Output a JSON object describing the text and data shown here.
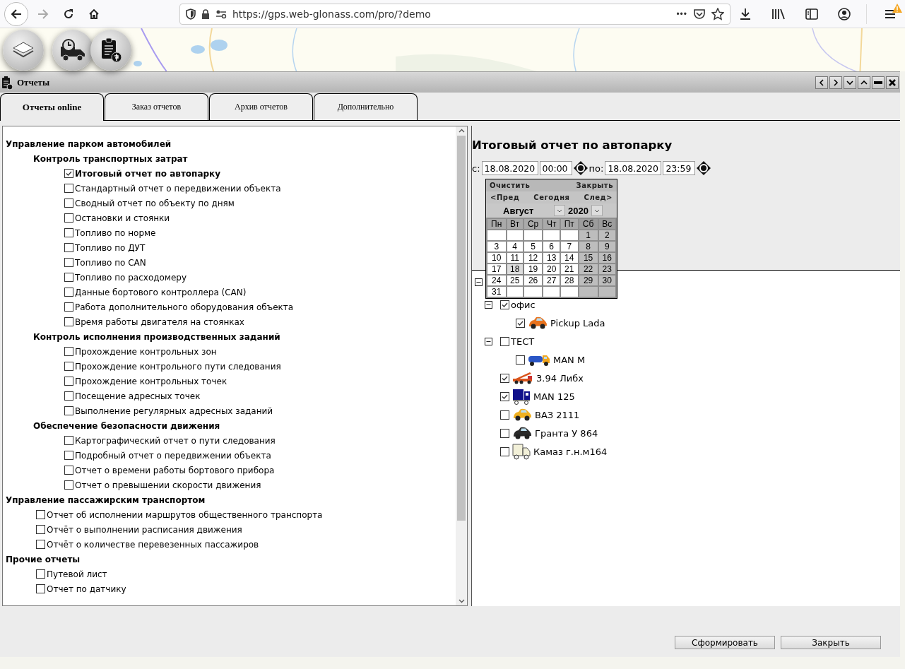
{
  "browser": {
    "url": "https://gps.web-glonass.com/pro/?demo",
    "more": "•••"
  },
  "window": {
    "title": "Отчеты"
  },
  "tabs": [
    {
      "label": "Отчеты online",
      "selected": true
    },
    {
      "label": "Заказ отчетов",
      "selected": false
    },
    {
      "label": "Архив отчетов",
      "selected": false
    },
    {
      "label": "Дополнительно",
      "selected": false
    }
  ],
  "reports": [
    {
      "kind": "heading",
      "label": "Управление парком автомобилей",
      "children": [
        {
          "kind": "heading",
          "label": "Контроль транспортных затрат",
          "children": [
            {
              "kind": "report",
              "label": "Итоговый отчет по автопарку",
              "checked": true
            },
            {
              "kind": "report",
              "label": "Стандартный отчет о передвижении объекта",
              "checked": false
            },
            {
              "kind": "report",
              "label": "Сводный отчет по объекту по дням",
              "checked": false
            },
            {
              "kind": "report",
              "label": "Остановки и стоянки",
              "checked": false
            },
            {
              "kind": "report",
              "label": "Топливо по норме",
              "checked": false
            },
            {
              "kind": "report",
              "label": "Топливо по ДУТ",
              "checked": false
            },
            {
              "kind": "report",
              "label": "Топливо по CAN",
              "checked": false
            },
            {
              "kind": "report",
              "label": "Топливо по расходомеру",
              "checked": false
            },
            {
              "kind": "report",
              "label": "Данные бортового контроллера (CAN)",
              "checked": false
            },
            {
              "kind": "report",
              "label": "Работа дополнительного оборудования объекта",
              "checked": false
            },
            {
              "kind": "report",
              "label": "Время работы двигателя на стоянках",
              "checked": false
            }
          ]
        },
        {
          "kind": "heading",
          "label": "Контроль исполнения производственных заданий",
          "children": [
            {
              "kind": "report",
              "label": "Прохождение контрольных зон",
              "checked": false
            },
            {
              "kind": "report",
              "label": "Прохождение контрольного пути следования",
              "checked": false
            },
            {
              "kind": "report",
              "label": "Прохождение контрольных точек",
              "checked": false
            },
            {
              "kind": "report",
              "label": "Посещение адресных точек",
              "checked": false
            },
            {
              "kind": "report",
              "label": "Выполнение регулярных адресных заданий",
              "checked": false
            }
          ]
        },
        {
          "kind": "heading",
          "label": "Обеспечение безопасности движения",
          "children": [
            {
              "kind": "report",
              "label": "Картографический отчет о пути следования",
              "checked": false
            },
            {
              "kind": "report",
              "label": "Подробный отчет о передвижении объекта",
              "checked": false
            },
            {
              "kind": "report",
              "label": "Отчет о времени работы бортового прибора",
              "checked": false
            },
            {
              "kind": "report",
              "label": "Отчет о превышении скорости движения",
              "checked": false
            }
          ]
        }
      ]
    },
    {
      "kind": "heading",
      "label": "Управление пассажирским транспортом",
      "children": [
        {
          "kind": "report",
          "label": "Отчет об исполнении маршрутов общественного транспорта",
          "checked": false
        },
        {
          "kind": "report",
          "label": "Отчёт о выполнении расписания движения",
          "checked": false
        },
        {
          "kind": "report",
          "label": "Отчёт о количестве перевезенных пассажиров",
          "checked": false
        }
      ]
    },
    {
      "kind": "heading",
      "label": "Прочие отчеты",
      "children": [
        {
          "kind": "report",
          "label": "Путевой лист",
          "checked": false
        },
        {
          "kind": "report",
          "label": "Отчет по датчику",
          "checked": false
        }
      ]
    }
  ],
  "summary": {
    "title": "Итоговый отчет по автопарку",
    "from_label": "с:",
    "from_date": "18.08.2020",
    "from_time": "00:00",
    "to_label": "по:",
    "to_date": "18.08.2020",
    "to_time": "23:59"
  },
  "calendar": {
    "clear": "Очистить",
    "close": "Закрыть",
    "prev": "<Пред",
    "today": "Сегодня",
    "next": "След>",
    "month": "Август",
    "year": "2020",
    "weekdays": [
      {
        "label": "Пн",
        "weekend": false
      },
      {
        "label": "Вт",
        "weekend": false
      },
      {
        "label": "Ср",
        "weekend": false
      },
      {
        "label": "Чт",
        "weekend": false
      },
      {
        "label": "Пт",
        "weekend": false
      },
      {
        "label": "Сб",
        "weekend": true
      },
      {
        "label": "Вс",
        "weekend": true
      }
    ],
    "weeks": [
      [
        {
          "kind": "blank"
        },
        {
          "kind": "blank"
        },
        {
          "kind": "blank"
        },
        {
          "kind": "blank"
        },
        {
          "kind": "blank"
        },
        {
          "day": "1",
          "selected": false
        },
        {
          "day": "2",
          "selected": false
        }
      ],
      [
        {
          "day": "3",
          "selected": false
        },
        {
          "day": "4",
          "selected": false
        },
        {
          "day": "5",
          "selected": false
        },
        {
          "day": "6",
          "selected": false
        },
        {
          "day": "7",
          "selected": false
        },
        {
          "day": "8",
          "selected": false
        },
        {
          "day": "9",
          "selected": false
        }
      ],
      [
        {
          "day": "10",
          "selected": false
        },
        {
          "day": "11",
          "selected": false
        },
        {
          "day": "12",
          "selected": false
        },
        {
          "day": "13",
          "selected": false
        },
        {
          "day": "14",
          "selected": false
        },
        {
          "day": "15",
          "selected": false
        },
        {
          "day": "16",
          "selected": false
        }
      ],
      [
        {
          "day": "17",
          "selected": false
        },
        {
          "day": "18",
          "selected": true
        },
        {
          "day": "19",
          "selected": false
        },
        {
          "day": "20",
          "selected": false
        },
        {
          "day": "21",
          "selected": false
        },
        {
          "day": "22",
          "selected": false
        },
        {
          "day": "23",
          "selected": false
        }
      ],
      [
        {
          "day": "24",
          "selected": false
        },
        {
          "day": "25",
          "selected": false
        },
        {
          "day": "26",
          "selected": false
        },
        {
          "day": "27",
          "selected": false
        },
        {
          "day": "28",
          "selected": false
        },
        {
          "day": "29",
          "selected": false
        },
        {
          "day": "30",
          "selected": false
        }
      ],
      [
        {
          "day": "31",
          "selected": false
        },
        {
          "kind": "blank"
        },
        {
          "kind": "blank"
        },
        {
          "kind": "blank"
        },
        {
          "kind": "blank"
        },
        {
          "kind": "blank"
        },
        {
          "kind": "blank"
        }
      ]
    ]
  },
  "tree": {
    "expanded": true,
    "children": [
      {
        "kind": "group",
        "label": "офис",
        "checked": true,
        "expanded": true,
        "children": [
          {
            "kind": "car",
            "label": "Pickup Lada",
            "checked": true,
            "color": "#e8731e"
          }
        ]
      },
      {
        "kind": "group",
        "label": "ТЕСТ",
        "checked": false,
        "expanded": true,
        "children": [
          {
            "kind": "tanker",
            "label": "MAN M",
            "checked": false,
            "color": "#f2a51c"
          }
        ]
      },
      {
        "kind": "crane",
        "label": "3.94 Либх",
        "checked": true,
        "color": "#d9541c"
      },
      {
        "kind": "lorry",
        "label": "MAN 125",
        "checked": true,
        "color": "#10108a"
      },
      {
        "kind": "car",
        "label": "ВАЗ 2111",
        "checked": false,
        "color": "#f0b020"
      },
      {
        "kind": "car",
        "label": "Гранта У 864",
        "checked": false,
        "color": "#2a2a2a"
      },
      {
        "kind": "van",
        "label": "Камаз г.н.м164",
        "checked": false,
        "color": "#f2f0d8"
      }
    ]
  },
  "buttons": [
    "Сформировать",
    "Закрыть"
  ]
}
